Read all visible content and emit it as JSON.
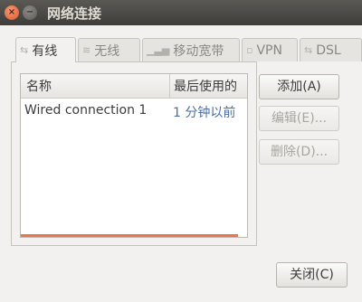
{
  "window": {
    "title": "网络连接"
  },
  "titlebar_buttons": {
    "close": "×",
    "minimize": "−"
  },
  "tabs": [
    {
      "label": "有线",
      "icon": "wired-icon",
      "glyph": "⇆"
    },
    {
      "label": "无线",
      "icon": "wifi-icon",
      "glyph": "≋"
    },
    {
      "label": "移动宽带",
      "icon": "signal-icon",
      "glyph": "▁▃▅"
    },
    {
      "label": "VPN",
      "icon": "lock-icon",
      "glyph": "▫"
    },
    {
      "label": "DSL",
      "icon": "dsl-icon",
      "glyph": "⇆"
    }
  ],
  "table": {
    "headers": [
      "名称",
      "最后使用的"
    ],
    "rows": [
      {
        "name": "Wired connection 1",
        "last_used": "1 分钟以前"
      }
    ]
  },
  "buttons": {
    "add": "添加(A)",
    "edit": "编辑(E)...",
    "delete": "删除(D)...",
    "close": "关闭(C)"
  },
  "colors": {
    "accent": "#e8784b",
    "link_text": "#4a6da5"
  }
}
